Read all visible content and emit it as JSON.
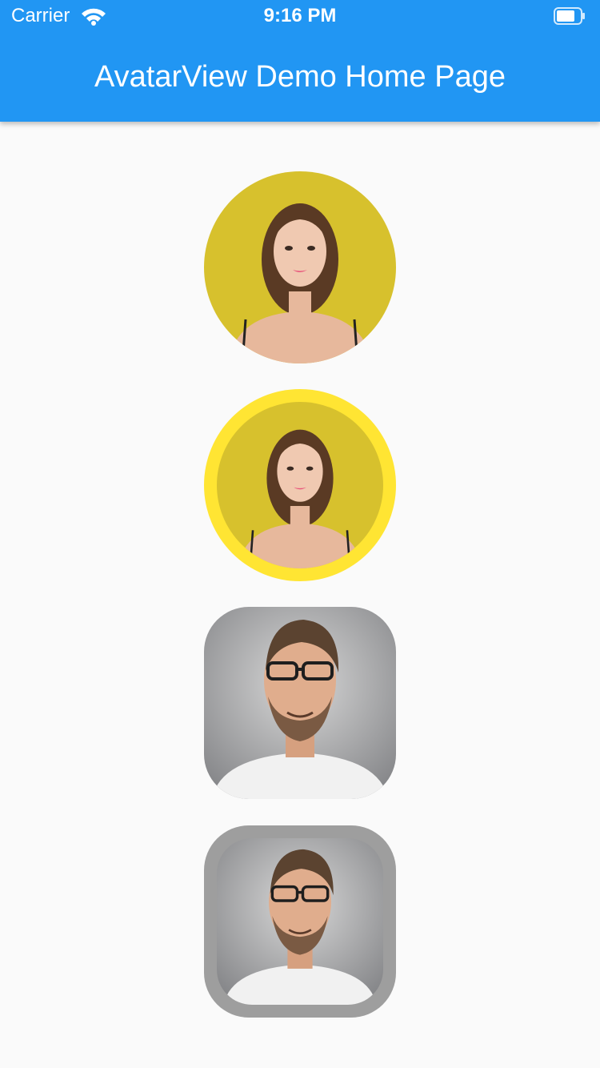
{
  "status_bar": {
    "carrier": "Carrier",
    "time": "9:16 PM"
  },
  "app_bar": {
    "title": "AvatarView Demo Home Page"
  },
  "avatars": [
    {
      "shape": "circle",
      "border": false,
      "subject": "woman-photo"
    },
    {
      "shape": "circle",
      "border": true,
      "border_color": "#ffe533",
      "subject": "woman-photo"
    },
    {
      "shape": "rounded-rect",
      "border": false,
      "subject": "man-photo"
    },
    {
      "shape": "rounded-rect",
      "border": true,
      "border_color": "#9e9e9e",
      "subject": "man-photo"
    }
  ],
  "colors": {
    "app_bar": "#2196f3",
    "background": "#fafafa",
    "yellow_border": "#ffe533",
    "grey_border": "#9e9e9e"
  }
}
